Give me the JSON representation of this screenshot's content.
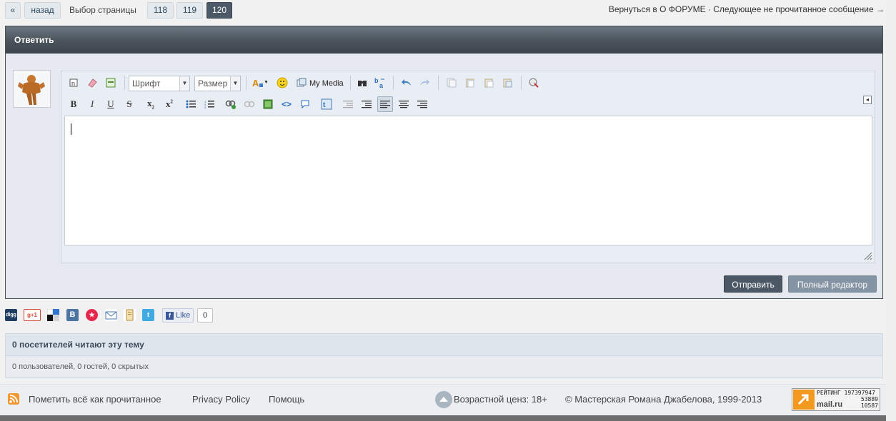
{
  "pagination": {
    "first": "«",
    "back": "назад",
    "label": "Выбор страницы",
    "pages": [
      "118",
      "119",
      "120"
    ],
    "current": "120"
  },
  "top_links": {
    "text": "Вернуться в О ФОРУМЕ · Следующее не прочитанное сообщение →"
  },
  "reply": {
    "title": "Ответить",
    "font_select": "Шрифт",
    "size_select": "Размер",
    "my_media": "My Media",
    "send_button": "Отправить",
    "full_editor_button": "Полный редактор"
  },
  "toolbar_icons": {
    "row1": [
      "remove-format-icon",
      "eraser-icon",
      "toggle-editor-icon",
      "font-color-icon",
      "emoticon-icon",
      "my-media-icon",
      "find-icon",
      "replace-icon",
      "undo-icon",
      "redo-icon",
      "cut-icon",
      "copy-icon",
      "paste-icon",
      "paste-text-icon",
      "spellcheck-icon"
    ],
    "row2": [
      "bold-icon",
      "italic-icon",
      "underline-icon",
      "strikethrough-icon",
      "subscript-icon",
      "superscript-icon",
      "bullet-list-icon",
      "numbered-list-icon",
      "link-icon",
      "unlink-icon",
      "image-icon",
      "code-icon",
      "quote-icon",
      "twitter-icon",
      "outdent-icon",
      "indent-icon",
      "align-left-icon",
      "align-center-icon",
      "align-right-icon"
    ]
  },
  "share": {
    "like_label": "Like",
    "like_count": "0"
  },
  "viewers": {
    "title": "0 посетителей читают эту тему",
    "details": "0 пользователей, 0 гостей, 0 скрытых"
  },
  "footer": {
    "mark_read": "Пометить всё как прочитанное",
    "privacy": "Privacy Policy",
    "help": "Помощь",
    "age": "Возрастной ценз: 18+",
    "copyright": "© Мастерская Романа Джабелова, 1999-2013",
    "counter_lines": [
      "РЕЙТИНГ 197397947",
      "53889",
      "10587"
    ],
    "counter_brand": "mail.ru"
  },
  "colors": {
    "header_bg": "#4a535c",
    "active_page": "#4c5967",
    "send_button": "#4d5866",
    "full_editor_button": "#8594a4"
  }
}
